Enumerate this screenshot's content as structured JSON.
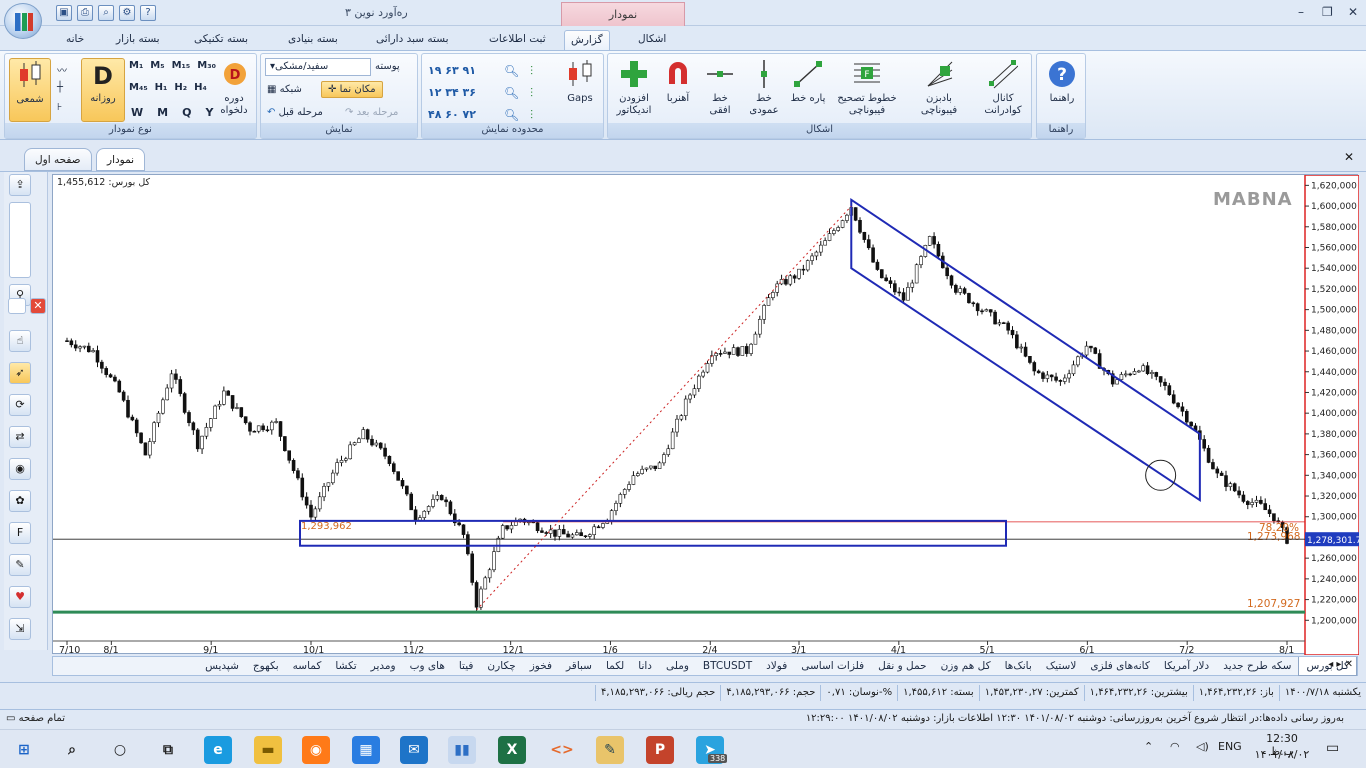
{
  "window": {
    "title": "ره‌آورد نوین ۳",
    "context_tab": "نمودار",
    "controls": [
      "–",
      "❐",
      "✕"
    ]
  },
  "ribbon_tabs": [
    {
      "label": "خانه"
    },
    {
      "label": "بسته بازار"
    },
    {
      "label": "بسته تکنیکی"
    },
    {
      "label": "بسته بنیادی"
    },
    {
      "label": "بسته سبد دارائی"
    },
    {
      "label": "ثبت اطلاعات"
    },
    {
      "label": "گزارش"
    },
    {
      "label": "اشکال"
    }
  ],
  "ribbon": {
    "chart_type": {
      "label": "نوع نمودار",
      "candle": "شمعی",
      "daily": "روزانه",
      "custom_period": "دوره دلخواه",
      "period_letters": [
        "W",
        "M",
        "Q",
        "Y"
      ],
      "d_letter": "D"
    },
    "display": {
      "label": "نمایش",
      "background_label": "پوسته",
      "background_value": "سفید/مشکی",
      "grid": "شبکه",
      "cursor": "مکان نما",
      "prev_step": "مرحله قبل",
      "next_step": "مرحله بعد"
    },
    "display_range": {
      "label": "محدوده نمایش",
      "gaps": "Gaps"
    },
    "shapes": {
      "label": "اشکال",
      "add_indicator": "افزودن اندیکاتور",
      "magnet": "آهنربا",
      "hline": "خط افقی",
      "vline": "خط عمودی",
      "segment": "پاره خط",
      "fib_retrace": "خطوط تصحیح فیبوناچی",
      "fib_fan": "بادبزن فیبوناچی",
      "quad_channel": "کانال کوادرانت"
    },
    "help": {
      "label": "راهنما",
      "button": "راهنما"
    }
  },
  "doc_tabs": [
    "صفحه اول",
    "نمودار"
  ],
  "chart_info": {
    "brand": "MABNA",
    "index_label": "کل بورس: 1,455,612"
  },
  "chart_data": {
    "type": "candlestick",
    "title": "",
    "ylim": [
      1180000,
      1630000
    ],
    "yticks": [
      1200000,
      1220000,
      1240000,
      1260000,
      1280000,
      1300000,
      1320000,
      1340000,
      1360000,
      1380000,
      1400000,
      1420000,
      1440000,
      1460000,
      1480000,
      1500000,
      1520000,
      1540000,
      1560000,
      1580000,
      1600000,
      1620000
    ],
    "xticks": [
      "7/10",
      "8/1",
      "9/1",
      "10/1",
      "11/2",
      "12/1",
      "1/6",
      "2/4",
      "3/1",
      "4/1",
      "5/1",
      "6/1",
      "7/2",
      "8/1"
    ],
    "current_price_label": "1,278,301.7",
    "fib_levels": [
      {
        "value": 1273968,
        "label": "1,273,968",
        "pct": "78.20%"
      },
      {
        "value": 1207927,
        "label": "1,207,927"
      }
    ],
    "inbox_label": "1,293,962",
    "anchor_points": [
      {
        "t": 0,
        "v": 1470000
      },
      {
        "t": 6,
        "v": 1460000
      },
      {
        "t": 12,
        "v": 1420000
      },
      {
        "t": 18,
        "v": 1360000
      },
      {
        "t": 24,
        "v": 1440000
      },
      {
        "t": 30,
        "v": 1370000
      },
      {
        "t": 36,
        "v": 1420000
      },
      {
        "t": 42,
        "v": 1385000
      },
      {
        "t": 48,
        "v": 1390000
      },
      {
        "t": 56,
        "v": 1300000
      },
      {
        "t": 62,
        "v": 1350000
      },
      {
        "t": 68,
        "v": 1380000
      },
      {
        "t": 74,
        "v": 1355000
      },
      {
        "t": 80,
        "v": 1300000
      },
      {
        "t": 86,
        "v": 1320000
      },
      {
        "t": 91,
        "v": 1282000
      },
      {
        "t": 94,
        "v": 1216000
      },
      {
        "t": 96,
        "v": 1240000
      },
      {
        "t": 100,
        "v": 1288000
      },
      {
        "t": 104,
        "v": 1298000
      },
      {
        "t": 112,
        "v": 1284000
      },
      {
        "t": 118,
        "v": 1280000
      },
      {
        "t": 124,
        "v": 1300000
      },
      {
        "t": 130,
        "v": 1340000
      },
      {
        "t": 136,
        "v": 1350000
      },
      {
        "t": 142,
        "v": 1410000
      },
      {
        "t": 148,
        "v": 1460000
      },
      {
        "t": 156,
        "v": 1460000
      },
      {
        "t": 162,
        "v": 1520000
      },
      {
        "t": 168,
        "v": 1535000
      },
      {
        "t": 174,
        "v": 1565000
      },
      {
        "t": 180,
        "v": 1600000
      },
      {
        "t": 186,
        "v": 1535000
      },
      {
        "t": 192,
        "v": 1510000
      },
      {
        "t": 198,
        "v": 1568000
      },
      {
        "t": 204,
        "v": 1520000
      },
      {
        "t": 210,
        "v": 1500000
      },
      {
        "t": 216,
        "v": 1480000
      },
      {
        "t": 222,
        "v": 1440000
      },
      {
        "t": 228,
        "v": 1430000
      },
      {
        "t": 234,
        "v": 1465000
      },
      {
        "t": 240,
        "v": 1430000
      },
      {
        "t": 246,
        "v": 1445000
      },
      {
        "t": 252,
        "v": 1425000
      },
      {
        "t": 258,
        "v": 1390000
      },
      {
        "t": 264,
        "v": 1340000
      },
      {
        "t": 270,
        "v": 1318000
      },
      {
        "t": 274,
        "v": 1310000
      },
      {
        "t": 277,
        "v": 1300000
      },
      {
        "t": 280,
        "v": 1278000
      }
    ],
    "total_bars": 281
  },
  "symbols": [
    "کل بورس",
    "سکه طرح جدید",
    "دلار آمریکا",
    "کانه‌های فلزی",
    "لاستیک",
    "بانک‌ها",
    "کل هم وزن",
    "حمل و نقل",
    "فلزات اساسی",
    "فولاد",
    "BTCUSDT",
    "وملی",
    "دانا",
    "لکما",
    "سباقر",
    "فخوز",
    "چکارن",
    "فیتا",
    "های وب",
    "ومدیر",
    "تکشا",
    "کماسه",
    "بکهوج",
    "شپدیس"
  ],
  "status_bar": [
    "یکشنبه ۱۴۰۰/۷/۱۸",
    "باز: ۱,۴۶۴,۲۳۲,۲۶",
    "بیشترین: ۱,۴۶۴,۲۳۲,۲۶",
    "کمترین: ۱,۴۵۳,۲۳۰,۲۷",
    "بسته: ۱,۴۵۵,۶۱۲",
    "نوسان: ۰,۷۱-%",
    "حجم: ۴,۱۸۵,۲۹۳,۰۶۶",
    "حجم ریالی: ۴,۱۸۵,۲۹۳,۰۶۶"
  ],
  "status_bar2": {
    "left": "تمام صفحه",
    "right": "به‌روز رسانی داده‌ها:در انتظار شروع   آخرین به‌روزرسانی: دوشنبه ۱۴۰۱/۰۸/۰۲ ۱۲:۳۰   اطلاعات بازار: دوشنبه ۱۴۰۱/۰۸/۰۲ ۱۲:۲۹:۰۰"
  },
  "taskbar": {
    "lang": "ENG",
    "time": "12:30 ب.ظ",
    "date": "۱۴۰۱/۰۸/۰۲",
    "telegram_badge": "338"
  }
}
